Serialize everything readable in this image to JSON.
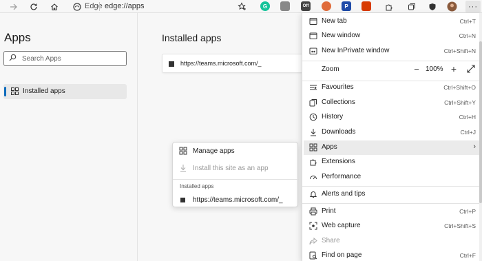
{
  "toolbar": {
    "browser_label": "Edge",
    "address": "edge://apps",
    "icons": [
      "forward-icon",
      "refresh-icon",
      "home-icon",
      "edge-logo-icon",
      "favorite-add-icon",
      "grammarly-icon",
      "extension-icon",
      "odoo-icon",
      "profile-icon",
      "pdf-icon",
      "office-icon",
      "puzzle-icon",
      "collections-icon",
      "shield-icon",
      "avatar",
      "more-icon"
    ],
    "ext_badge": "Off"
  },
  "sidebar": {
    "title": "Apps",
    "search_placeholder": "Search Apps",
    "items": [
      {
        "label": "Installed apps",
        "icon": "apps-grid-icon",
        "active": true
      }
    ]
  },
  "main": {
    "title": "Installed apps",
    "apps": [
      {
        "url": "https://teams.microsoft.com/_"
      }
    ]
  },
  "apps_submenu": {
    "items": [
      {
        "label": "Manage apps",
        "icon": "apps-grid-icon",
        "enabled": true
      },
      {
        "label": "Install this site as an app",
        "icon": "download-icon",
        "enabled": false
      }
    ],
    "section_title": "Installed apps",
    "installed": [
      {
        "url": "https://teams.microsoft.com/_"
      }
    ]
  },
  "menu": {
    "items_group1": [
      {
        "label": "New tab",
        "shortcut": "Ctrl+T",
        "icon": "new-tab-icon"
      },
      {
        "label": "New window",
        "shortcut": "Ctrl+N",
        "icon": "new-window-icon"
      },
      {
        "label": "New InPrivate window",
        "shortcut": "Ctrl+Shift+N",
        "icon": "inprivate-icon"
      }
    ],
    "zoom": {
      "label": "Zoom",
      "value": "100%",
      "minus": "−",
      "plus": "+"
    },
    "items_group2": [
      {
        "label": "Favourites",
        "shortcut": "Ctrl+Shift+O",
        "icon": "favourites-icon"
      },
      {
        "label": "Collections",
        "shortcut": "Ctrl+Shift+Y",
        "icon": "collections-icon"
      },
      {
        "label": "History",
        "shortcut": "Ctrl+H",
        "icon": "history-icon"
      },
      {
        "label": "Downloads",
        "shortcut": "Ctrl+J",
        "icon": "download-icon"
      },
      {
        "label": "Apps",
        "shortcut": "",
        "icon": "apps-grid-icon",
        "submenu": true
      },
      {
        "label": "Extensions",
        "shortcut": "",
        "icon": "puzzle-icon"
      },
      {
        "label": "Performance",
        "shortcut": "",
        "icon": "performance-icon"
      }
    ],
    "items_group3": [
      {
        "label": "Alerts and tips",
        "shortcut": "",
        "icon": "bell-icon"
      }
    ],
    "items_group4": [
      {
        "label": "Print",
        "shortcut": "Ctrl+P",
        "icon": "print-icon"
      },
      {
        "label": "Web capture",
        "shortcut": "Ctrl+Shift+S",
        "icon": "web-capture-icon"
      },
      {
        "label": "Share",
        "shortcut": "",
        "icon": "share-icon",
        "enabled": false
      },
      {
        "label": "Find on page",
        "shortcut": "Ctrl+F",
        "icon": "find-icon"
      }
    ]
  },
  "colors": {
    "accent": "#0f6cbd",
    "hover": "#ebebeb",
    "menu_bg": "#ffffff",
    "page_bg": "#f7f7f7"
  }
}
